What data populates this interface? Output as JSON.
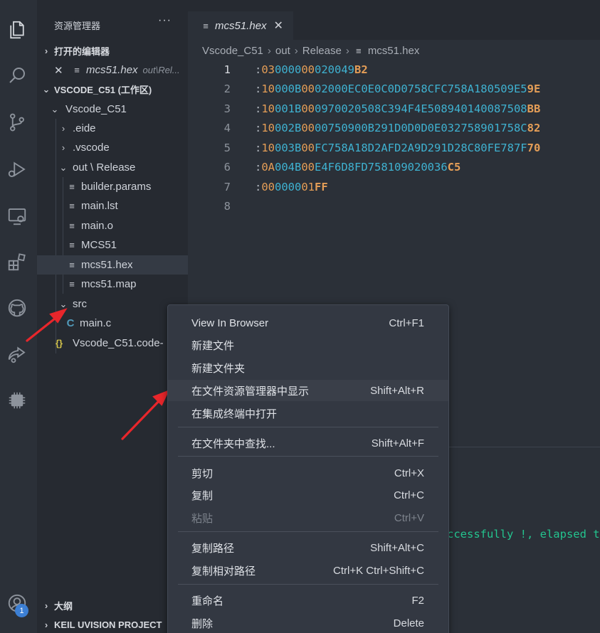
{
  "sidebar": {
    "title": "资源管理器",
    "more": "···",
    "open_editors_section": "打开的编辑器",
    "open_editor": {
      "name": "mcs51.hex",
      "path": "out\\Rel..."
    },
    "workspace_section": "VSCODE_C51 (工作区)",
    "tree": {
      "root": "Vscode_C51",
      "eide": ".eide",
      "vscode": ".vscode",
      "out_release": "out \\ Release",
      "files": [
        "builder.params",
        "main.lst",
        "main.o",
        "MCS51",
        "mcs51.hex",
        "mcs51.map"
      ],
      "src": "src",
      "main_c": "main.c",
      "workspace_file": "Vscode_C51.code-"
    },
    "outline_section": "大纲",
    "keil_section": "KEIL UVISION PROJECT"
  },
  "activity": {
    "badge": "1"
  },
  "editor": {
    "tab_label": "mcs51.hex",
    "tab_close": "✕",
    "breadcrumb": [
      "Vscode_C51",
      "out",
      "Release",
      "mcs51.hex"
    ],
    "lines": [
      {
        "num": "1",
        "len": "03",
        "addr": "0000",
        "type": "00",
        "data": "020049",
        "sum": "B2"
      },
      {
        "num": "2",
        "len": "10",
        "addr": "000B",
        "type": "00",
        "data": "02000EC0E0C0D0758CFC758A180509E5",
        "sum": "9E"
      },
      {
        "num": "3",
        "len": "10",
        "addr": "001B",
        "type": "00",
        "data": "0970020508C394F4E508940140087508",
        "sum": "BB"
      },
      {
        "num": "4",
        "len": "10",
        "addr": "002B",
        "type": "00",
        "data": "00750900B291D0D0D0E032758901758C",
        "sum": "82"
      },
      {
        "num": "5",
        "len": "10",
        "addr": "003B",
        "type": "00",
        "data": "FC758A18D2AFD2A9D291D28C80FE787F",
        "sum": "70"
      },
      {
        "num": "6",
        "len": "0A",
        "addr": "004B",
        "type": "00",
        "data": "E4F6D8FD758109020036",
        "sum": "C5"
      },
      {
        "num": "7",
        "len": "00",
        "addr": "0000",
        "type": "01",
        "data": "",
        "sum": "FF"
      },
      {
        "num": "8",
        "len": "",
        "addr": "",
        "type": "",
        "data": "",
        "sum": ""
      }
    ]
  },
  "terminal": {
    "text": "ccessfully !, elapsed ti"
  },
  "context_menu": {
    "items": [
      {
        "label": "View In Browser",
        "shortcut": "Ctrl+F1"
      },
      {
        "label": "新建文件",
        "shortcut": ""
      },
      {
        "label": "新建文件夹",
        "shortcut": ""
      },
      {
        "label": "在文件资源管理器中显示",
        "shortcut": "Shift+Alt+R"
      },
      {
        "label": "在集成终端中打开",
        "shortcut": ""
      },
      {
        "label": "在文件夹中查找...",
        "shortcut": "Shift+Alt+F"
      },
      {
        "label": "剪切",
        "shortcut": "Ctrl+X"
      },
      {
        "label": "复制",
        "shortcut": "Ctrl+C"
      },
      {
        "label": "粘贴",
        "shortcut": "Ctrl+V"
      },
      {
        "label": "复制路径",
        "shortcut": "Shift+Alt+C"
      },
      {
        "label": "复制相对路径",
        "shortcut": "Ctrl+K Ctrl+Shift+C"
      },
      {
        "label": "重命名",
        "shortcut": "F2"
      },
      {
        "label": "删除",
        "shortcut": "Delete"
      }
    ]
  },
  "colors": {
    "annotation_arrow": "#e8262b",
    "hex_orange": "#e59e57",
    "hex_cyan": "#3fb2d1",
    "success_green": "#23c48e"
  }
}
